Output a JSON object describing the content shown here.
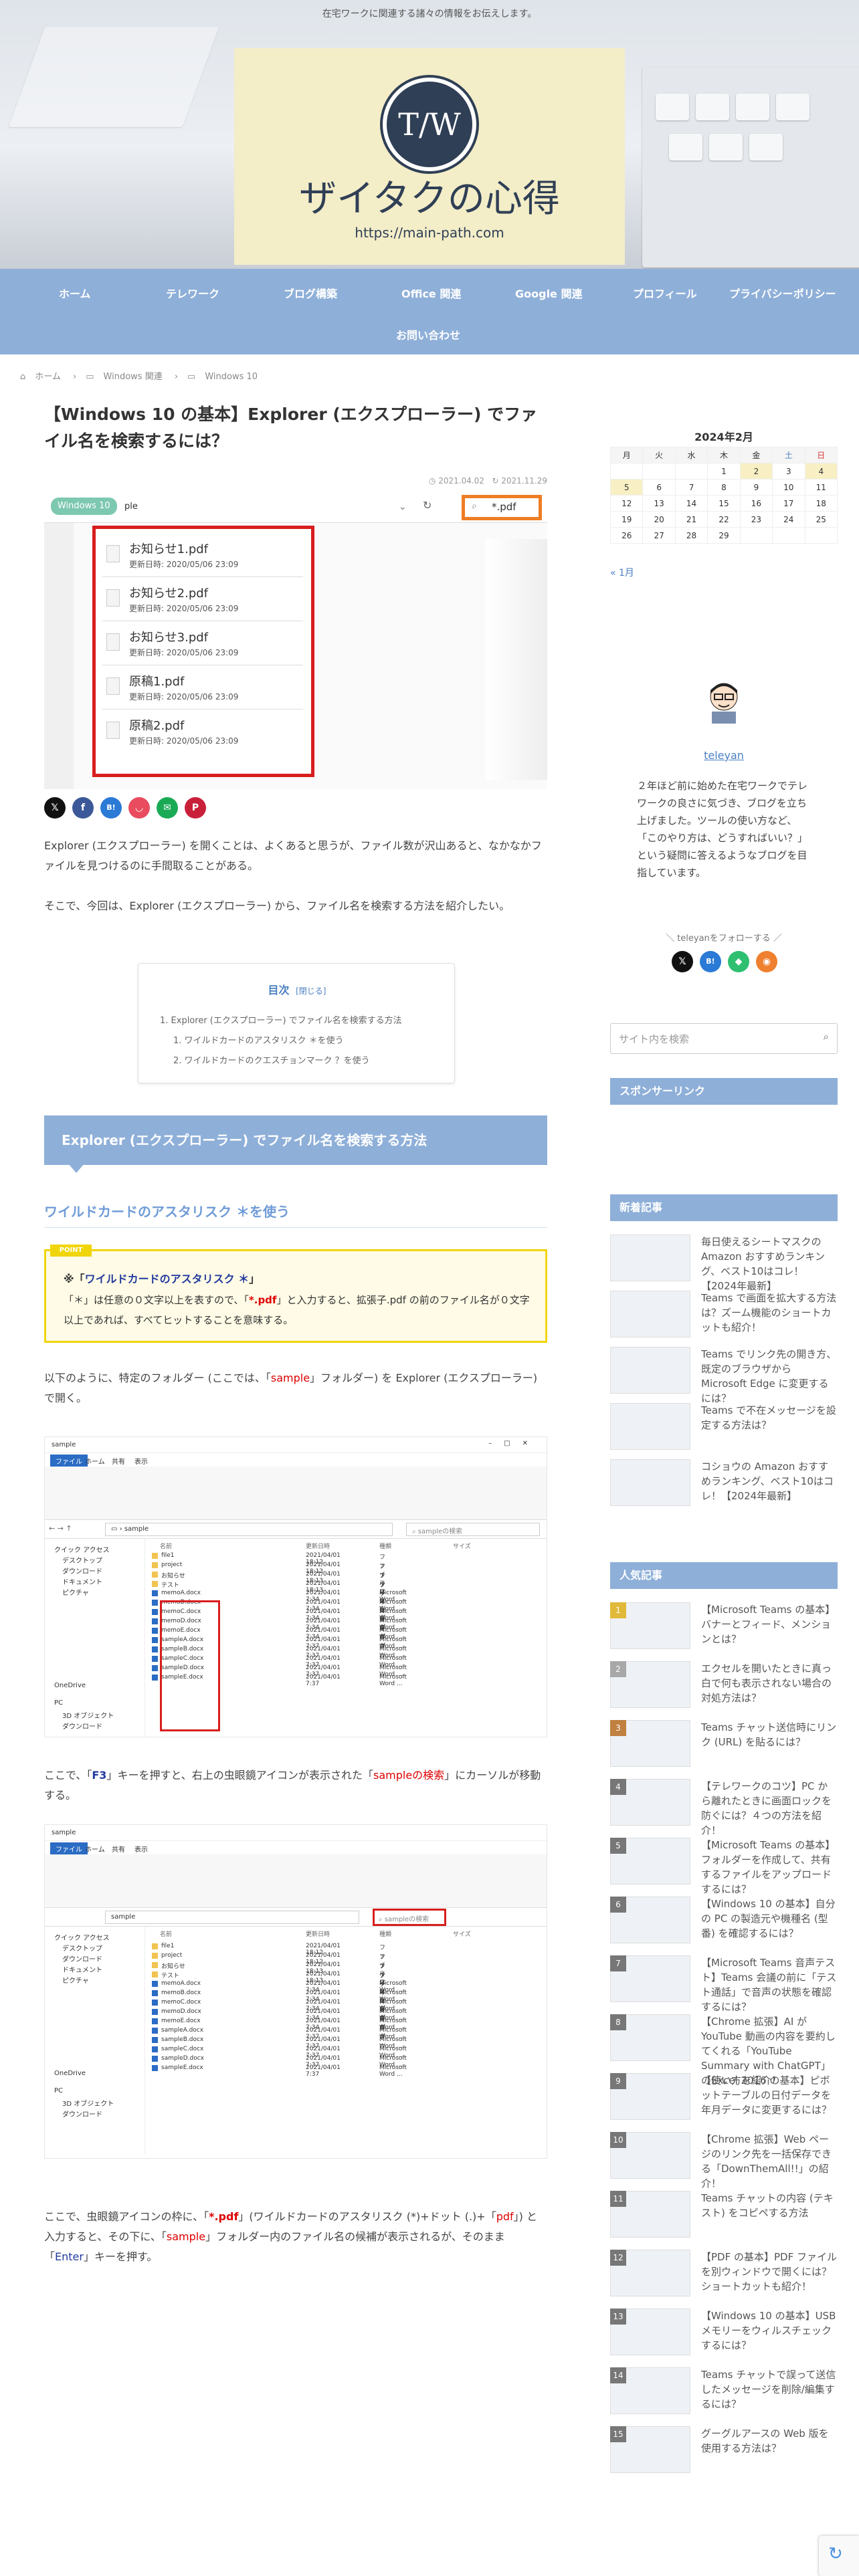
{
  "header": {
    "tagline": "在宅ワークに関連する諸々の情報をお伝えします。",
    "logo_mark": "T/W",
    "site_title": "ザイタクの心得",
    "site_url": "https://main-path.com"
  },
  "nav": {
    "items": [
      "ホーム",
      "テレワーク",
      "ブログ構築",
      "Office 関連",
      "Google 関連",
      "プロフィール",
      "プライバシーポリシー",
      "お問い合わせ"
    ]
  },
  "breadcrumb": [
    "ホーム",
    "Windows 関連",
    "Windows 10"
  ],
  "post": {
    "title": "【Windows 10 の基本】Explorer (エクスプローラー) でファイル名を検索するには？",
    "date_published": "2021.04.02",
    "date_updated": "2021.11.29",
    "intro1": "Explorer (エクスプローラー) を開くことは、よくあると思うが、ファイル数が沢山あると、なかなかファイルを見つけるのに手間取ることがある。",
    "intro2": "そこで、今回は、Explorer (エクスプローラー) から、ファイル名を検索する方法を紹介したい。",
    "toc": {
      "title": "目次",
      "toggle": "[閉じる]",
      "items": [
        "1. Explorer (エクスプローラー) でファイル名を検索する方法",
        "1. ワイルドカードのアスタリスク ＊を使う",
        "2. ワイルドカードのクエスチョンマーク ？を使う"
      ]
    },
    "h2": "Explorer (エクスプローラー) でファイル名を検索する方法",
    "h3": "ワイルドカードのアスタリスク ＊を使う",
    "point": {
      "tag": "POINT",
      "heading_prefix": "※「",
      "heading": "ワイルドカードのアスタリスク ＊",
      "heading_suffix": "」",
      "body_a": "「＊」は任意の０文字以上を表すので、「",
      "body_b": "*.pdf",
      "body_c": "」と入力すると、拡張子.pdf の前のファイル名が０文字以上であれば、すべてヒットすることを意味する。"
    },
    "para3_a": "以下のように、特定のフォルダー (ここでは、「",
    "para3_b": "sample",
    "para3_c": "」フォルダー) を Explorer (エクスプローラー) で開く。",
    "para4_a": "ここで、「",
    "para4_b": "F3",
    "para4_c": "」キーを押すと、右上の虫眼鏡アイコンが表示された「",
    "para4_d": "sampleの検索",
    "para4_e": "」にカーソルが移動する。",
    "para5_a": "ここで、虫眼鏡アイコンの枠に、「",
    "para5_b": "*.pdf",
    "para5_c": "」(ワイルドカードのアスタリスク (*)+ドット (.)+「",
    "para5_d": "pdf",
    "para5_e": "」) と入力すると、その下に、「",
    "para5_f": "sample",
    "para5_g": "」フォルダー内のファイル名の候補が表示されるが、そのまま「",
    "para5_h": "Enter",
    "para5_i": "」キーを押す。"
  },
  "eyecatch": {
    "badge": "Windows 10",
    "search_value": "*.pdf",
    "folder": "ple",
    "updated_label": "更新日時: 2020/05/06 23:09",
    "files": [
      "お知らせ1.pdf",
      "お知らせ2.pdf",
      "お知らせ3.pdf",
      "原稿1.pdf",
      "原稿2.pdf"
    ]
  },
  "explorer": {
    "tabs": [
      "ファイル",
      "ホーム",
      "共有",
      "表示"
    ],
    "path": "sample",
    "search_placeholder": "sampleの検索",
    "cols": [
      "名前",
      "更新日時",
      "種類",
      "サイズ"
    ],
    "tree": [
      "クイック アクセス",
      "デスクトップ",
      "ダウンロード",
      "ドキュメント",
      "ピクチャ",
      "OneDrive",
      "PC",
      "3D オブジェクト",
      "ダウンロード"
    ],
    "rows": [
      [
        "file1",
        "2021/04/01 18:12",
        "ファイル フォルダー"
      ],
      [
        "project",
        "2021/04/01 18:12",
        "ファイル フォルダー"
      ],
      [
        "お知らせ",
        "2021/04/01 18:13",
        "ファイル フォルダー"
      ],
      [
        "テスト",
        "2021/04/01 18:13",
        "ファイル フォルダー"
      ],
      [
        "memoA.docx",
        "2021/04/01 7:34",
        "Microsoft Word ..."
      ],
      [
        "memoB.docx",
        "2021/04/01 7:34",
        "Microsoft Word ..."
      ],
      [
        "memoC.docx",
        "2021/04/01 7:34",
        "Microsoft Word ..."
      ],
      [
        "memoD.docx",
        "2021/04/01 7:34",
        "Microsoft Word ..."
      ],
      [
        "memoE.docx",
        "2021/04/01 7:34",
        "Microsoft Word ..."
      ],
      [
        "sampleA.docx",
        "2021/04/01 7:37",
        "Microsoft Word ..."
      ],
      [
        "sampleB.docx",
        "2021/04/01 7:37",
        "Microsoft Word ..."
      ],
      [
        "sampleC.docx",
        "2021/04/01 7:37",
        "Microsoft Word ..."
      ],
      [
        "sampleD.docx",
        "2021/04/01 7:37",
        "Microsoft Word ..."
      ],
      [
        "sampleE.docx",
        "2021/04/01 7:37",
        "Microsoft Word ..."
      ]
    ]
  },
  "sidebar": {
    "calendar": {
      "title": "2024年2月",
      "days": [
        "月",
        "火",
        "水",
        "木",
        "金",
        "土",
        "日"
      ],
      "weeks": [
        [
          "",
          "",
          "",
          "1",
          "2",
          "3",
          "4"
        ],
        [
          "5",
          "6",
          "7",
          "8",
          "9",
          "10",
          "11"
        ],
        [
          "12",
          "13",
          "14",
          "15",
          "16",
          "17",
          "18"
        ],
        [
          "19",
          "20",
          "21",
          "22",
          "23",
          "24",
          "25"
        ],
        [
          "26",
          "27",
          "28",
          "29",
          "",
          "",
          ""
        ]
      ],
      "prev": "« 1月"
    },
    "profile": {
      "name": "teleyan",
      "bio": "２年ほど前に始めた在宅ワークでテレワークの良さに気づき、ブログを立ち上げました。ツールの使い方など、「このやり方は、どうすればいい？」という疑問に答えるようなブログを目指しています。",
      "follow": "＼ teleyanをフォローする ／"
    },
    "search_placeholder": "サイト内を検索",
    "sponsor": "スポンサーリンク",
    "recent_title": "新着記事",
    "recent": [
      "毎日使えるシートマスクの Amazon おすすめランキング、ベスト10はコレ！【2024年最新】",
      "Teams で画面を拡大する方法は？ズーム機能のショートカットも紹介！",
      "Teams でリンク先の開き方、既定のブラウザから Microsoft Edge に変更するには？",
      "Teams で不在メッセージを設定する方法は？",
      "コショウの Amazon おすすめランキング、ベスト10はコレ！【2024年最新】"
    ],
    "popular_title": "人気記事",
    "popular": [
      "【Microsoft Teams の基本】バナーとフィード、メンションとは？",
      "エクセルを開いたときに真っ白で何も表示されない場合の対処方法は？",
      "Teams チャット送信時にリンク (URL) を貼るには？",
      "【テレワークのコツ】PC から離れたときに画面ロックを防ぐには？４つの方法を紹介！",
      "【Microsoft Teams の基本】フォルダーを作成して、共有するファイルをアップロードするには？",
      "【Windows 10 の基本】自分の PC の製造元や機種名 (型番) を確認するには？",
      "【Microsoft Teams 音声テスト】Teams 会議の前に「テスト通話」で音声の状態を確認するには？",
      "【Chrome 拡張】AI が YouTube 動画の内容を要約してくれる「YouTube Summary with ChatGPT」の使い方を紹介！",
      "【Excel 2016 の基本】ピボットテーブルの日付データを年月データに変更するには？",
      "【Chrome 拡張】Web ページのリンク先を一括保存できる「DownThemAll!!」の紹介！",
      "Teams チャットの内容 (テキスト) をコピペする方法",
      "【PDF の基本】PDF ファイルを別ウィンドウで開くには？ショートカットも紹介！",
      "【Windows 10 の基本】USBメモリーをウィルスチェックするには？",
      "Teams チャットで誤って送信したメッセージを削除/編集するには？",
      "グーグルアースの Web 版を使用する方法は？"
    ],
    "popular_nums": [
      "1",
      "2",
      "3",
      "4",
      "5",
      "6",
      "7",
      "8",
      "9",
      "10",
      "11",
      "12",
      "13",
      "14",
      "15"
    ]
  },
  "colors": {
    "accent": "#8eafd8",
    "red": "#dd0000",
    "navy": "#2f3f55",
    "yellow": "#f0d50a"
  }
}
